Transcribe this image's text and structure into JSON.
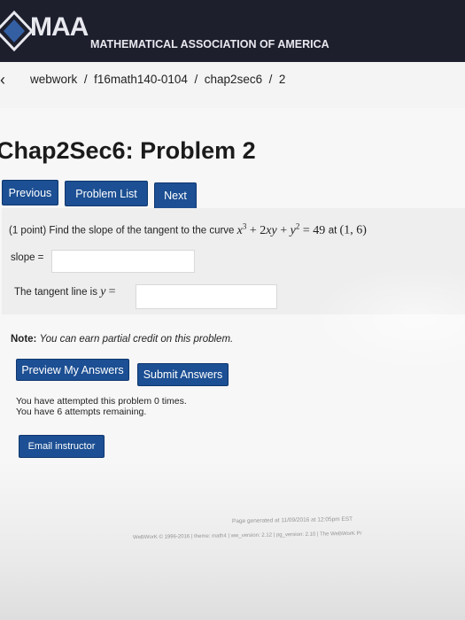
{
  "header": {
    "logo": "MAA",
    "org_name": "MATHEMATICAL ASSOCIATION OF AMERICA",
    "brand_color": "#1d1f2d"
  },
  "breadcrumb": {
    "items": [
      "webwork",
      "f16math140-0104",
      "chap2sec6",
      "2"
    ],
    "separator": "/"
  },
  "page": {
    "title": "Chap2Sec6: Problem 2"
  },
  "nav_buttons": {
    "previous": "Previous",
    "problem_list": "Problem List",
    "next": "Next"
  },
  "problem": {
    "prefix": "(1 point) Find the slope of the tangent to the curve",
    "equation": "x³ + 2xy + y² = 49",
    "at_word": "at",
    "point": "(1, 6)",
    "slope_label": "slope =",
    "slope_value": "",
    "tangent_label_prefix": "The tangent line is",
    "tangent_var": "y",
    "tangent_eq": "=",
    "tangent_value": ""
  },
  "note": {
    "label": "Note:",
    "text": "You can earn partial credit on this problem."
  },
  "actions": {
    "preview": "Preview My Answers",
    "submit": "Submit Answers",
    "email": "Email instructor"
  },
  "attempts": {
    "line1": "You have attempted this problem 0 times.",
    "line2": "You have 6 attempts remaining."
  },
  "footer": {
    "generated": "Page generated at 11/09/2016 at 12:05pm EST",
    "credits": "WeBWorK © 1996-2016 | theme: math4 | ww_version: 2.12 | pg_version: 2.10 | The WeBWorK Pr"
  },
  "colors": {
    "button_blue": "#1c4f93",
    "page_bg": "#f7f7f7",
    "problem_bg": "#eeeeee"
  }
}
